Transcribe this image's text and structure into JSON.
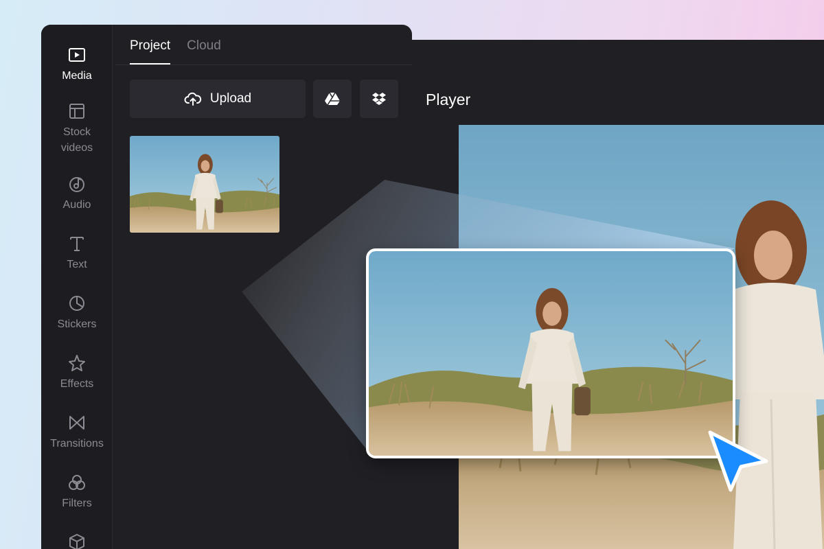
{
  "sidebar": {
    "items": [
      {
        "label": "Media",
        "icon": "play-icon",
        "active": true
      },
      {
        "label": "Stock\nvideos",
        "icon": "layout-icon"
      },
      {
        "label": "Audio",
        "icon": "music-disc-icon"
      },
      {
        "label": "Text",
        "icon": "text-t-icon"
      },
      {
        "label": "Stickers",
        "icon": "sticker-icon"
      },
      {
        "label": "Effects",
        "icon": "sparkle-star-icon"
      },
      {
        "label": "Transitions",
        "icon": "bowtie-icon"
      },
      {
        "label": "Filters",
        "icon": "circles-icon"
      },
      {
        "label": "",
        "icon": "cube-icon"
      }
    ]
  },
  "tabs": {
    "project": "Project",
    "cloud": "Cloud",
    "active": "Project"
  },
  "toolbar": {
    "upload_label": "Upload",
    "upload_icon": "cloud-upload-icon",
    "google_drive_icon": "google-drive-icon",
    "dropbox_icon": "dropbox-icon"
  },
  "player": {
    "title": "Player"
  },
  "colors": {
    "panel": "#1f1f24",
    "sidebar": "#1c1c21",
    "button": "#2a2a30",
    "accent_cursor": "#1a8cff",
    "sky": "#7fb6d1",
    "sand": "#c9ad84"
  }
}
